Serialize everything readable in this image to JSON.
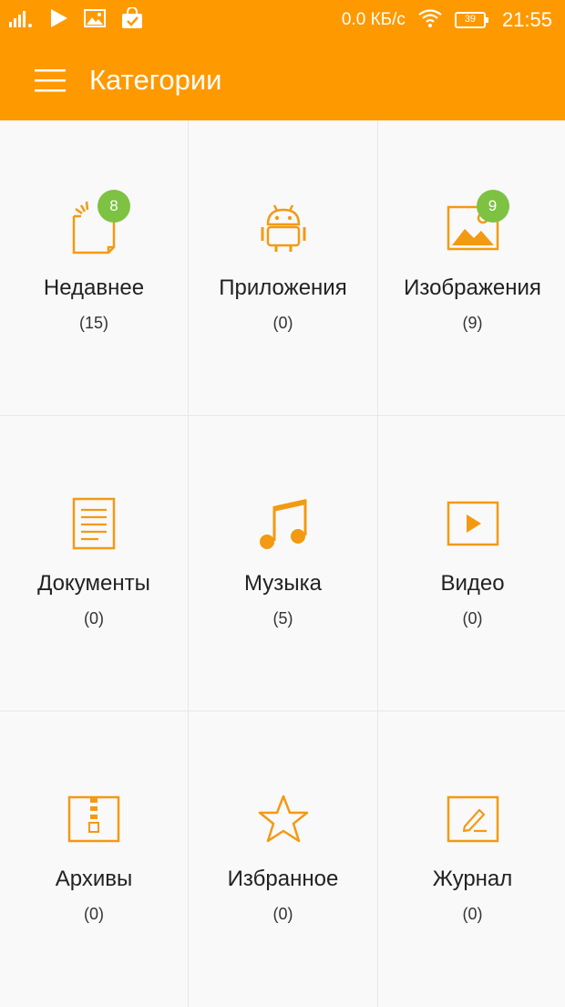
{
  "status_bar": {
    "speed": "0.0 КБ/с",
    "battery": "39",
    "time": "21:55"
  },
  "header": {
    "title": "Категории"
  },
  "colors": {
    "accent": "#ff9900",
    "icon": "#f39a13",
    "badge": "#7dc242"
  },
  "categories": [
    {
      "label": "Недавнее",
      "count": "(15)",
      "badge": "8",
      "icon": "recent-icon"
    },
    {
      "label": "Приложения",
      "count": "(0)",
      "icon": "android-icon"
    },
    {
      "label": "Изображения",
      "count": "(9)",
      "badge": "9",
      "icon": "image-icon"
    },
    {
      "label": "Документы",
      "count": "(0)",
      "icon": "document-icon"
    },
    {
      "label": "Музыка",
      "count": "(5)",
      "icon": "music-icon"
    },
    {
      "label": "Видео",
      "count": "(0)",
      "icon": "video-icon"
    },
    {
      "label": "Архивы",
      "count": "(0)",
      "icon": "archive-icon"
    },
    {
      "label": "Избранное",
      "count": "(0)",
      "icon": "star-icon"
    },
    {
      "label": "Журнал",
      "count": "(0)",
      "icon": "journal-icon"
    }
  ]
}
